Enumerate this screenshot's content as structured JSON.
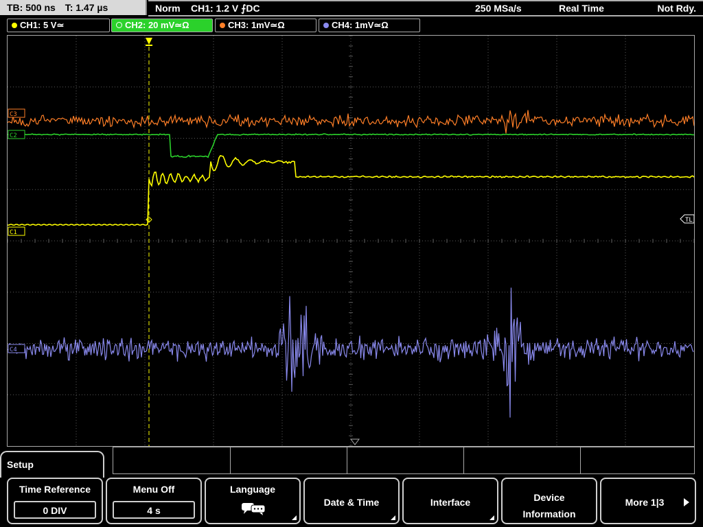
{
  "status": {
    "timebase": "TB: 500 ns",
    "trigger_time": "T: 1.47 µs",
    "mode": "Norm",
    "trigger": "CH1: 1.2 V ⨍DC",
    "sample_rate": "250 MSa/s",
    "acquisition": "Real Time",
    "state": "Not Rdy."
  },
  "channels": [
    {
      "label": "CH1: 5 V≃",
      "color": "#ffff00"
    },
    {
      "label": "CH2: 20 mV≃Ω",
      "color": "#2bd12b"
    },
    {
      "label": "CH3: 1mV≃Ω",
      "color": "#ff7f27"
    },
    {
      "label": "CH4: 1mV≃Ω",
      "color": "#8a8aee"
    }
  ],
  "markers": {
    "c3": "C3",
    "c2": "C2",
    "c1": "C1",
    "c4": "C4",
    "trigger_level": "TL",
    "trigger_pos": "T"
  },
  "menu": {
    "title": "Setup",
    "time_reference": {
      "label": "Time Reference",
      "value": "0 DIV"
    },
    "menu_off": {
      "label": "Menu Off",
      "value": "4 s"
    },
    "language": {
      "label": "Language"
    },
    "date_time": {
      "label": "Date & Time"
    },
    "interface": {
      "label": "Interface"
    },
    "device_information": {
      "line1": "Device",
      "line2": "Information"
    },
    "more": {
      "label": "More 1|3"
    }
  },
  "colors": {
    "ch1": "#ffff00",
    "ch2": "#2bd12b",
    "ch3": "#ff7f27",
    "ch4": "#8a8aee",
    "grid": "#5a5a5a"
  }
}
